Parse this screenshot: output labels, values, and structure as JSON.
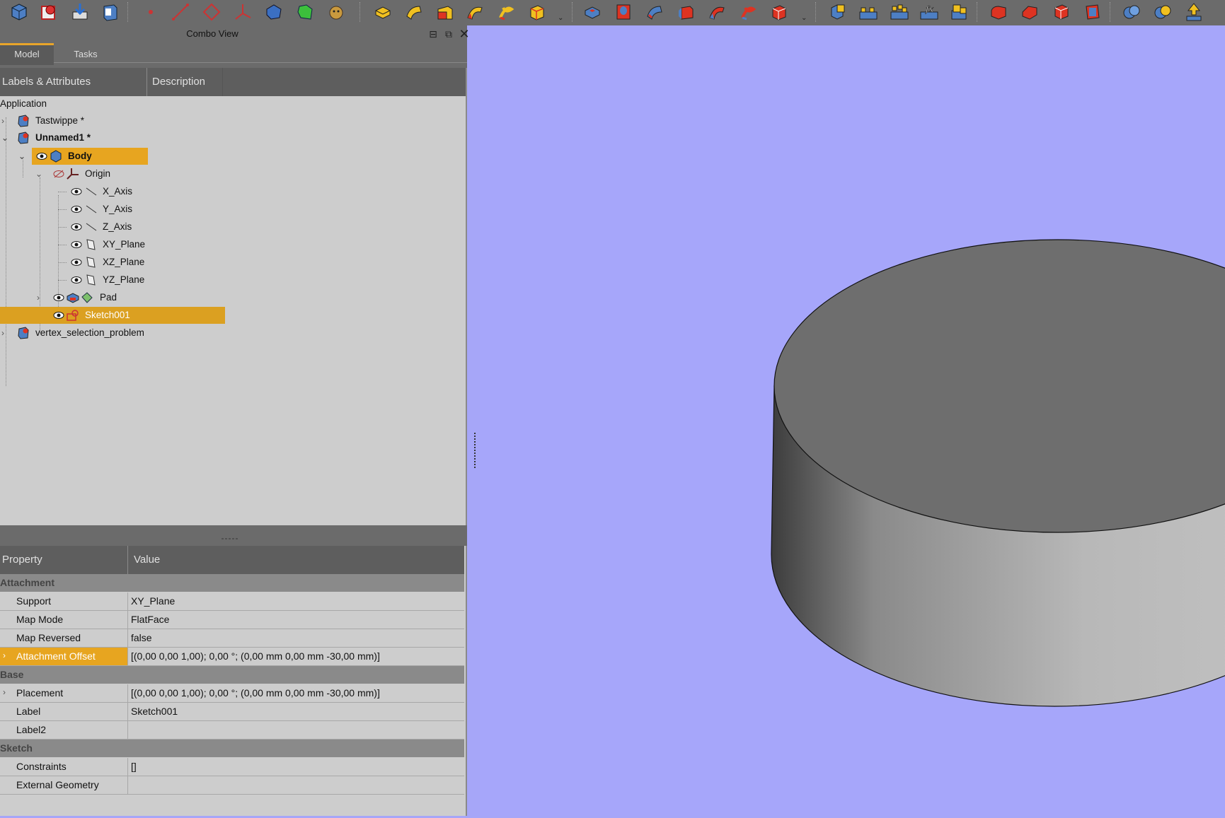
{
  "combo": {
    "title": "Combo View",
    "tabs": [
      {
        "label": "Model"
      },
      {
        "label": "Tasks"
      }
    ]
  },
  "tree": {
    "headers": [
      "Labels & Attributes",
      "Description"
    ],
    "root": "Application",
    "items": [
      {
        "label": "Tastwippe *"
      },
      {
        "label": "Unnamed1 *"
      },
      {
        "label": "Body"
      },
      {
        "label": "Origin"
      },
      {
        "label": "X_Axis"
      },
      {
        "label": "Y_Axis"
      },
      {
        "label": "Z_Axis"
      },
      {
        "label": "XY_Plane"
      },
      {
        "label": "XZ_Plane"
      },
      {
        "label": "YZ_Plane"
      },
      {
        "label": "Pad"
      },
      {
        "label": "Sketch001"
      },
      {
        "label": "vertex_selection_problem"
      }
    ]
  },
  "properties": {
    "headers": [
      "Property",
      "Value"
    ],
    "groups": [
      {
        "name": "Attachment",
        "rows": [
          {
            "name": "Support",
            "value": "XY_Plane"
          },
          {
            "name": "Map Mode",
            "value": "FlatFace"
          },
          {
            "name": "Map Reversed",
            "value": "false"
          },
          {
            "name": "Attachment Offset",
            "value": "[(0,00 0,00 1,00); 0,00 °; (0,00 mm  0,00 mm  -30,00 mm)]"
          }
        ]
      },
      {
        "name": "Base",
        "rows": [
          {
            "name": "Placement",
            "value": "[(0,00 0,00 1,00); 0,00 °; (0,00 mm  0,00 mm  -30,00 mm)]"
          },
          {
            "name": "Label",
            "value": "Sketch001"
          },
          {
            "name": "Label2",
            "value": ""
          }
        ]
      },
      {
        "name": "Sketch",
        "rows": [
          {
            "name": "Constraints",
            "value": "[]"
          },
          {
            "name": "External Geometry",
            "value": ""
          }
        ]
      }
    ]
  },
  "colors": {
    "selection": "#e7a520",
    "viewport_bg": "#a6a6fa",
    "panel_bg": "#cdcdcd",
    "header_bg": "#5e5e5e",
    "cylinder_top": "#6e6e6e"
  },
  "toolbar_icons": [
    "body-icon",
    "part-icon",
    "import-icon",
    "shape-binder-icon",
    "point-icon",
    "line-icon",
    "plane-icon",
    "lcs-icon",
    "clone-icon",
    "subshape-binder-icon",
    "sprocket-icon",
    "pad-icon",
    "revolution-icon",
    "additive-loft-icon",
    "additive-pipe-icon",
    "additive-helix-icon",
    "additive-box-icon",
    "pocket-icon",
    "hole-icon",
    "groove-icon",
    "subtractive-loft-icon",
    "subtractive-pipe-icon",
    "subtractive-helix-icon",
    "subtractive-box-icon",
    "mirrored-icon",
    "linear-pattern-icon",
    "polar-pattern-icon",
    "multi-transform-icon",
    "scaled-icon",
    "fillet-icon",
    "chamfer-icon",
    "draft-icon",
    "thickness-icon",
    "boolean-icon",
    "boolean-intersect-icon",
    "export-icon"
  ]
}
